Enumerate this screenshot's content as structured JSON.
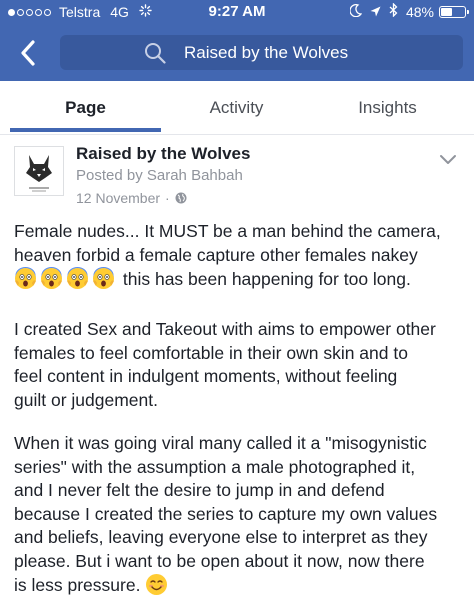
{
  "status_bar": {
    "carrier": "Telstra",
    "network": "4G",
    "time": "9:27 AM",
    "battery": "48%",
    "battery_level": 0.48,
    "signal_dots_filled": 1,
    "signal_dots_total": 5
  },
  "header": {
    "search_text": "Raised by the Wolves",
    "back_icon": "chevron-left-icon",
    "search_icon": "search-icon",
    "color": "#4267b2"
  },
  "tabs": [
    {
      "label": "Page",
      "active": true
    },
    {
      "label": "Activity",
      "active": false
    },
    {
      "label": "Insights",
      "active": false
    }
  ],
  "post": {
    "page_name": "Raised by the Wolves",
    "posted_by": "Posted by Sarah Bahbah",
    "date": "12 November",
    "separator": "·",
    "audience_icon": "globe-icon",
    "menu_icon": "chevron-down-icon",
    "paragraph1": [
      "Female nudes... It MUST be a man behind the camera,",
      "heaven forbid a female capture other females nakey",
      " this has been happening for too long."
    ],
    "paragraph2": [
      "I created Sex and Takeout with aims to empower other",
      "females to feel comfortable in their own skin and to",
      "feel content in indulgent moments, without feeling",
      "guilt or judgement."
    ],
    "paragraph3": [
      "When it was going viral many called it a  \"misogynistic",
      "series\" with the assumption a male photographed it,",
      "and I never felt the desire to jump in and defend",
      "because I created the series to capture my own values",
      "and beliefs, leaving everyone else to interpret as they",
      "please. But i want to be open about it now, now there",
      "is less pressure. "
    ],
    "emojis": [
      "screaming-face-emoji",
      "screaming-face-emoji",
      "screaming-face-emoji",
      "screaming-face-emoji",
      "smiling-face-emoji"
    ]
  }
}
